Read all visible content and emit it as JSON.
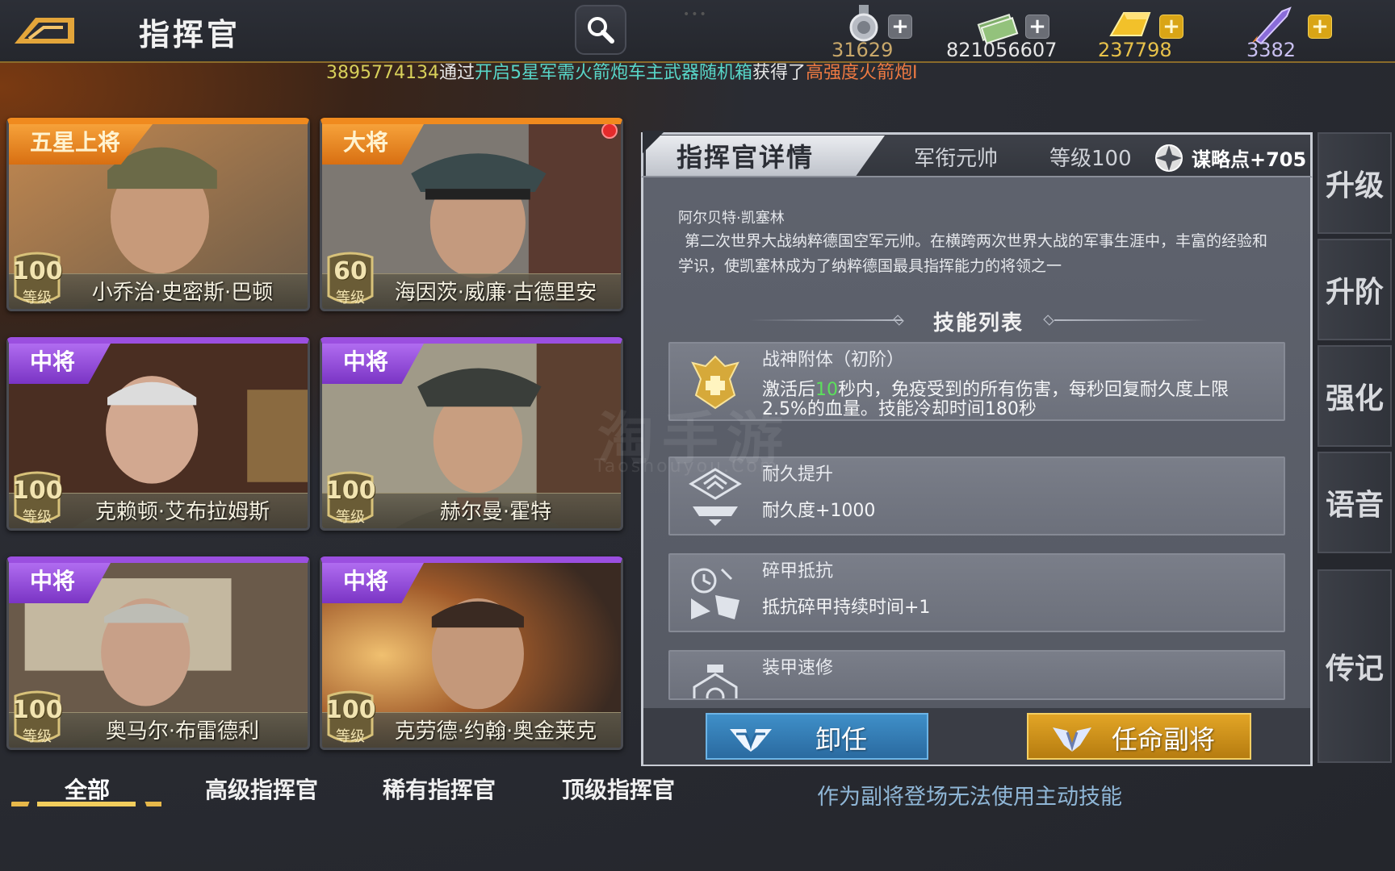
{
  "header": {
    "title": "指挥官",
    "resources": [
      {
        "icon": "medal-icon",
        "value": "31629",
        "plus": "gray"
      },
      {
        "icon": "cash-stack-icon",
        "value": "821056607",
        "plus": "gray"
      },
      {
        "icon": "gold-bar-icon",
        "value": "237798",
        "plus": "gold"
      },
      {
        "icon": "rocket-icon",
        "value": "3382",
        "plus": "gold"
      }
    ],
    "plus_label": "+"
  },
  "ticker": {
    "player_id": "3895774134",
    "text_via": "通过",
    "source": "开启5星军需火箭炮车主武器随机箱",
    "text_got": "获得了",
    "item": "高强度火箭炮I"
  },
  "commanders": [
    {
      "rank": "五星上将",
      "name": "小乔治·史密斯·巴顿",
      "level": "100",
      "level_label": "等级",
      "tier": "orange"
    },
    {
      "rank": "大将",
      "name": "海因茨·威廉·古德里安",
      "level": "60",
      "level_label": "等级",
      "tier": "orange"
    },
    {
      "rank": "中将",
      "name": "克赖顿·艾布拉姆斯",
      "level": "100",
      "level_label": "等级",
      "tier": "purple"
    },
    {
      "rank": "中将",
      "name": "赫尔曼·霍特",
      "level": "100",
      "level_label": "等级",
      "tier": "purple"
    },
    {
      "rank": "中将",
      "name": "奥马尔·布雷德利",
      "level": "100",
      "level_label": "等级",
      "tier": "purple"
    },
    {
      "rank": "中将",
      "name": "克劳德·约翰·奥金莱克",
      "level": "100",
      "level_label": "等级",
      "tier": "purple"
    }
  ],
  "filter_tabs": [
    "全部",
    "高级指挥官",
    "稀有指挥官",
    "顶级指挥官"
  ],
  "detail": {
    "title": "指挥官详情",
    "rank": "军衔元帅",
    "level": "等级100",
    "strategy_points": "谋略点+705",
    "bio_name": "阿尔贝特·凯塞林",
    "bio_text": "第二次世界大战纳粹德国空军元帅。在横跨两次世界大战的军事生涯中，丰富的经验和学识，使凯塞林成为了纳粹德国最具指挥能力的将领之一",
    "skills_heading": "技能列表",
    "skills": [
      {
        "icon": "eagle-emblem-icon",
        "name": "战神附体（初阶）",
        "desc_a": "激活后",
        "desc_hl": "10",
        "desc_b": "秒内，免疫受到的所有伤害，每秒回复耐久度上限2.5%的血量。技能冷却时间180秒"
      },
      {
        "icon": "ship-upgrade-icon",
        "name": "耐久提升",
        "desc": "耐久度+1000"
      },
      {
        "icon": "armor-break-resist-icon",
        "name": "碎甲抵抗",
        "desc": "抵抗碎甲持续时间+1"
      },
      {
        "icon": "armor-repair-icon",
        "name": "装甲速修",
        "desc": ""
      }
    ],
    "btn_dismiss": "卸任",
    "btn_appoint": "任命副将",
    "footer_note": "作为副将登场无法使用主动技能"
  },
  "side_tabs": [
    "升级",
    "升阶",
    "强化",
    "语音",
    "传记"
  ],
  "watermark": {
    "main": "淘手游",
    "sub": "Taoshouyou.Com"
  },
  "colors": {
    "orange_tier": "#f08a1e",
    "purple_tier": "#9b4fe0",
    "highlight": "#5ce05c",
    "ticker_source": "#58d6c8",
    "ticker_item": "#ee7a42"
  }
}
